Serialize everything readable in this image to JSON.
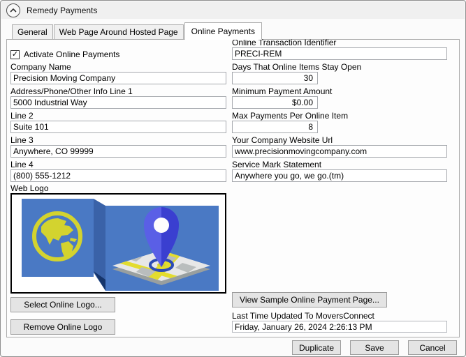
{
  "window": {
    "title": "Remedy Payments"
  },
  "icons": {
    "collapse": "chevron-up",
    "checkbox_check": "✓"
  },
  "tabs": [
    {
      "label": "General"
    },
    {
      "label": "Web Page Around Hosted Page"
    },
    {
      "label": "Online Payments"
    }
  ],
  "left": {
    "activate_checkbox": {
      "label": "Activate Online Payments",
      "checked": true
    },
    "fields": [
      {
        "label": "Company Name",
        "value": "Precision Moving Company"
      },
      {
        "label": "Address/Phone/Other Info Line 1",
        "value": "5000 Industrial Way"
      },
      {
        "label": "Line 2",
        "value": "Suite 101"
      },
      {
        "label": "Line 3",
        "value": "Anywhere, CO 99999"
      },
      {
        "label": "Line 4",
        "value": "(800) 555-1212"
      }
    ],
    "web_logo_label": "Web Logo",
    "select_logo_button": "Select Online Logo...",
    "remove_logo_button": "Remove Online Logo"
  },
  "right": {
    "fields": [
      {
        "label": "Online Transaction Identifier",
        "value": "PRECI-REM"
      },
      {
        "label": "Days That Online Items Stay Open",
        "value": "30"
      },
      {
        "label": "Minimum Payment Amount",
        "value": "$0.00"
      },
      {
        "label": "Max Payments Per Online Item",
        "value": "8"
      },
      {
        "label": "Your Company Website Url",
        "value": "www.precisionmovingcompany.com"
      },
      {
        "label": "Service Mark Statement",
        "value": "Anywhere you go, we go.(tm)"
      }
    ],
    "view_sample_button": "View Sample Online Payment Page...",
    "last_updated_label": "Last Time Updated To MoversConnect",
    "last_updated_value": "Friday, January 26, 2024 2:26:13 PM"
  },
  "footer_buttons": {
    "duplicate": "Duplicate",
    "save": "Save",
    "cancel": "Cancel"
  },
  "colors": {
    "logo_page_blue": "#4a79c4",
    "logo_fold_blue": "#3a62a8",
    "logo_globe_yellow": "#d3d32f",
    "pin_light_blue": "#5a5fe6",
    "pin_dark_blue": "#3a3fd0",
    "titlebar_gray": "#f0f0f0",
    "button_gray": "#e4e4e4"
  }
}
